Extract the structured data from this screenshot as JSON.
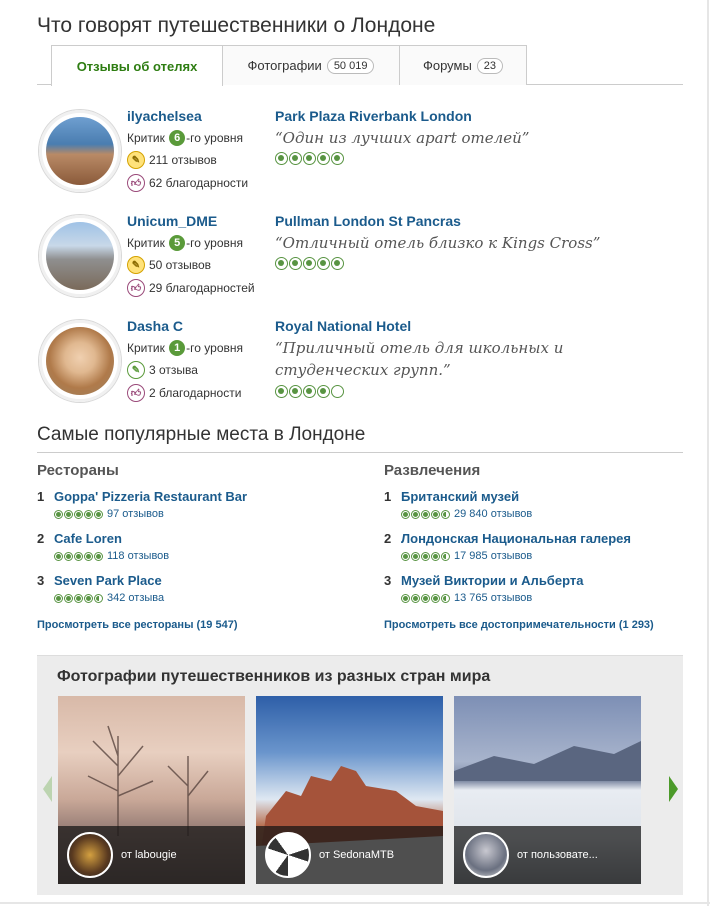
{
  "reviews_section": {
    "title": "Что говорят путешественники о Лондоне",
    "tabs": [
      {
        "label": "Отзывы об отелях",
        "count": ""
      },
      {
        "label": "Фотографии",
        "count": "50 019"
      },
      {
        "label": "Форумы",
        "count": "23"
      }
    ],
    "reviews": [
      {
        "user": "ilyachelsea",
        "level_prefix": "Критик",
        "level": "6",
        "level_suffix": "-го уровня",
        "reviews": "211 отзывов",
        "thanks": "62 благодарности",
        "hotel": "Park Plaza Riverbank London",
        "quote": "“Один из лучших apart отелей”",
        "rating": 5
      },
      {
        "user": "Unicum_DME",
        "level_prefix": "Критик",
        "level": "5",
        "level_suffix": "-го уровня",
        "reviews": "50 отзывов",
        "thanks": "29 благодарностей",
        "hotel": "Pullman London St Pancras",
        "quote": "“Отличный отель близко к Kings Cross”",
        "rating": 5
      },
      {
        "user": "Dasha C",
        "level_prefix": "Критик",
        "level": "1",
        "level_suffix": "-го уровня",
        "reviews": "3 отзыва",
        "thanks": "2 благодарности",
        "hotel": "Royal National Hotel",
        "quote": "“Приличный отель для школьных и студенческих групп.”",
        "rating": 4
      }
    ]
  },
  "popular": {
    "title": "Самые популярные места в Лондоне",
    "restaurants": {
      "heading": "Рестораны",
      "items": [
        {
          "num": "1",
          "name": "Goppa' Pizzeria Restaurant Bar",
          "count": "97 отзывов",
          "rating": 5
        },
        {
          "num": "2",
          "name": "Cafe Loren",
          "count": "118 отзывов",
          "rating": 5
        },
        {
          "num": "3",
          "name": "Seven Park Place",
          "count": "342 отзыва",
          "rating": 4.5
        }
      ],
      "view_all": "Просмотреть все рестораны (19 547)"
    },
    "attractions": {
      "heading": "Развлечения",
      "items": [
        {
          "num": "1",
          "name": "Британский музей",
          "count": "29 840 отзывов",
          "rating": 4.5
        },
        {
          "num": "2",
          "name": "Лондонская Национальная галерея",
          "count": "17 985 отзывов",
          "rating": 4.5
        },
        {
          "num": "3",
          "name": "Музей Виктории и Альберта",
          "count": "13 765 отзывов",
          "rating": 4.5
        }
      ],
      "view_all": "Просмотреть все достопримечательности (1 293)"
    }
  },
  "photos": {
    "title": "Фотографии путешественников из разных стран мира",
    "cards": [
      {
        "by": "от labougie"
      },
      {
        "by": "от SedonaMTB"
      },
      {
        "by": "от пользовате..."
      }
    ]
  },
  "colors": {
    "accent_green": "#589442",
    "link_blue": "#1b5b8c"
  }
}
